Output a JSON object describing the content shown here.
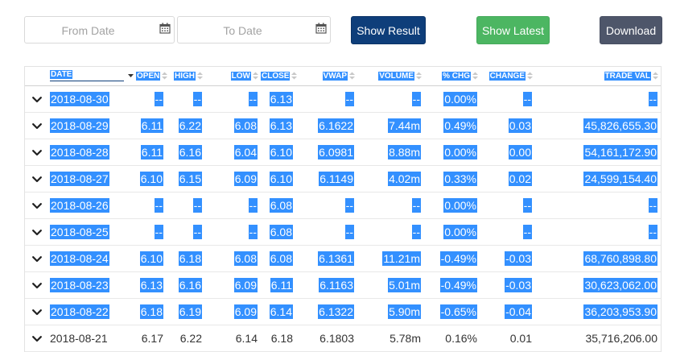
{
  "toolbar": {
    "from_placeholder": "From Date",
    "to_placeholder": "To Date",
    "show_result_label": "Show Result",
    "show_latest_label": "Show Latest",
    "download_label": "Download"
  },
  "table": {
    "columns": [
      "DATE",
      "OPEN",
      "HIGH",
      "LOW",
      "CLOSE",
      "VWAP",
      "VOLUME",
      "% CHG",
      "CHANGE",
      "TRADE VAL"
    ],
    "rows": [
      {
        "date": "2018-08-30",
        "open": "--",
        "high": "--",
        "low": "--",
        "close": "6.13",
        "vwap": "--",
        "volume": "--",
        "pchg": "0.00%",
        "change": "--",
        "tradeval": "--"
      },
      {
        "date": "2018-08-29",
        "open": "6.11",
        "high": "6.22",
        "low": "6.08",
        "close": "6.13",
        "vwap": "6.1622",
        "volume": "7.44m",
        "pchg": "0.49%",
        "change": "0.03",
        "tradeval": "45,826,655.30"
      },
      {
        "date": "2018-08-28",
        "open": "6.11",
        "high": "6.16",
        "low": "6.04",
        "close": "6.10",
        "vwap": "6.0981",
        "volume": "8.88m",
        "pchg": "0.00%",
        "change": "0.00",
        "tradeval": "54,161,172.90"
      },
      {
        "date": "2018-08-27",
        "open": "6.10",
        "high": "6.15",
        "low": "6.09",
        "close": "6.10",
        "vwap": "6.1149",
        "volume": "4.02m",
        "pchg": "0.33%",
        "change": "0.02",
        "tradeval": "24,599,154.40"
      },
      {
        "date": "2018-08-26",
        "open": "--",
        "high": "--",
        "low": "--",
        "close": "6.08",
        "vwap": "--",
        "volume": "--",
        "pchg": "0.00%",
        "change": "--",
        "tradeval": "--"
      },
      {
        "date": "2018-08-25",
        "open": "--",
        "high": "--",
        "low": "--",
        "close": "6.08",
        "vwap": "--",
        "volume": "--",
        "pchg": "0.00%",
        "change": "--",
        "tradeval": "--"
      },
      {
        "date": "2018-08-24",
        "open": "6.10",
        "high": "6.18",
        "low": "6.08",
        "close": "6.08",
        "vwap": "6.1361",
        "volume": "11.21m",
        "pchg": "-0.49%",
        "change": "-0.03",
        "tradeval": "68,760,898.80"
      },
      {
        "date": "2018-08-23",
        "open": "6.13",
        "high": "6.16",
        "low": "6.09",
        "close": "6.11",
        "vwap": "6.1163",
        "volume": "5.01m",
        "pchg": "-0.49%",
        "change": "-0.03",
        "tradeval": "30,623,062.00"
      },
      {
        "date": "2018-08-22",
        "open": "6.18",
        "high": "6.19",
        "low": "6.09",
        "close": "6.14",
        "vwap": "6.1322",
        "volume": "5.90m",
        "pchg": "-0.65%",
        "change": "-0.04",
        "tradeval": "36,203,953.90"
      },
      {
        "date": "2018-08-21",
        "open": "6.17",
        "high": "6.22",
        "low": "6.14",
        "close": "6.18",
        "vwap": "6.1803",
        "volume": "5.78m",
        "pchg": "0.16%",
        "change": "0.01",
        "tradeval": "35,716,206.00"
      }
    ]
  },
  "colors": {
    "primary": "#0e3e7a",
    "success": "#4cb662",
    "dark": "#4e566a",
    "selection": "#3390ff"
  },
  "icons": {
    "calendar": "calendar-icon",
    "sort": "sort-icon",
    "expand": "chevron-down-icon"
  }
}
